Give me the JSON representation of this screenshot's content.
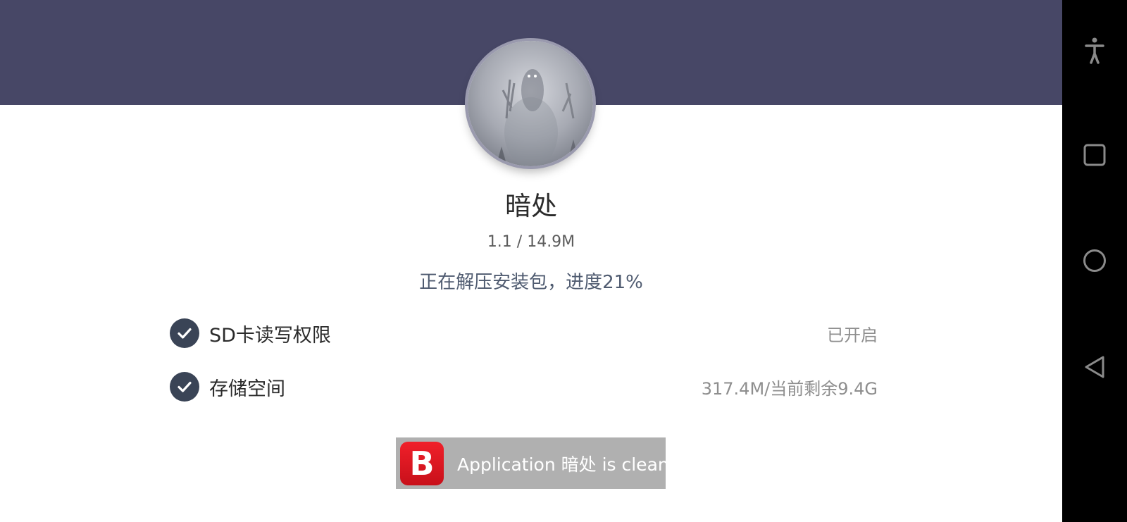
{
  "app": {
    "name": "暗处",
    "version_size": "1.1 / 14.9M",
    "progress_text": "正在解压安装包，进度21%",
    "progress_percent": 21,
    "avatar_icon": "app-avatar-ghost-image"
  },
  "permissions": [
    {
      "label": "SD卡读写权限",
      "status": "已开启",
      "icon": "check-circle-icon"
    },
    {
      "label": "存储空间",
      "status": "317.4M/当前剩余9.4G",
      "icon": "check-circle-icon"
    }
  ],
  "toast": {
    "logo_letter": "B",
    "logo_icon": "bitdefender-logo-icon",
    "message": "Application 暗处 is clean"
  },
  "nav_bar": {
    "buttons": [
      "accessibility-icon",
      "recents-icon",
      "home-icon",
      "back-icon"
    ]
  },
  "colors": {
    "header": "#474766",
    "check": "#3a4456",
    "progress_text": "#4f5b70",
    "toast_bg": "#b0b0b0",
    "logo_red": "#e01a22"
  }
}
